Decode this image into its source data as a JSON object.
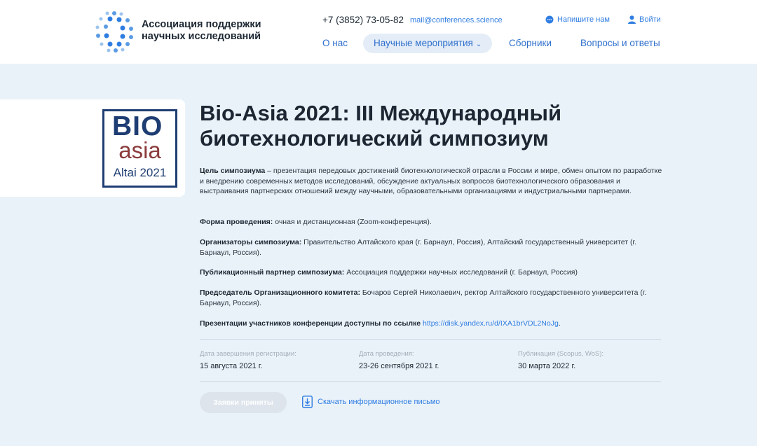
{
  "header": {
    "org_name": "Ассоциация поддержки научных исследований",
    "phone": "+7 (3852) 73-05-82",
    "email": "mail@conferences.science",
    "write_us": "Напишите нам",
    "login": "Войти",
    "nav": [
      {
        "label": "О нас"
      },
      {
        "label": "Научные мероприятия"
      },
      {
        "label": "Сборники"
      },
      {
        "label": "Вопросы и ответы"
      }
    ],
    "accent_color": "#2f7de1"
  },
  "cover": {
    "line1": "BIO",
    "line2": "asia",
    "line3": "Altai 2021"
  },
  "event": {
    "title": "Bio-Asia 2021: III Международный биотехнологический симпозиум",
    "goal_label": "Цель симпозиума",
    "goal_text": " – презентация передовых достижений биотехнологической отрасли в России и мире, обмен опытом по разработке и внедрению современных методов исследований, обсуждение актуальных вопросов биотехнологического образования и выстраивания партнерских отношений между научными, образовательными организациями и индустриальными партнерами.",
    "format_label": "Форма проведения:",
    "format_text": " очная и дистанционная (Zoom-конференция).",
    "organizers_label": "Организаторы симпозиума:",
    "organizers_text": " Правительство Алтайского края (г. Барнаул, Россия), Алтайский государственный университет (г. Барнаул, Россия).",
    "partner_label": "Публикационный партнер симпозиума:",
    "partner_text": " Ассоциация поддержки научных исследований (г. Барнаул, Россия)",
    "chair_label": "Председатель Организационного комитета:",
    "chair_text": " Бочаров Сергей Николаевич, ректор Алтайского государственного университета (г. Барнаул, Россия).",
    "presentations_label": "Презентации участников конференции доступны по ссылке",
    "presentations_link": "https://disk.yandex.ru/d/IXA1brVDL2NoJg",
    "dates": [
      {
        "label": "Дата завершения регистрации:",
        "value": "15 августа 2021 г."
      },
      {
        "label": "Дата проведения:",
        "value": "23-26 сентября 2021 г."
      },
      {
        "label": "Публикация (Scopus, WoS):",
        "value": "30 марта 2022 г."
      }
    ],
    "apply_button": "Заявки приняты",
    "download_label": "Скачать информационное письмо"
  }
}
